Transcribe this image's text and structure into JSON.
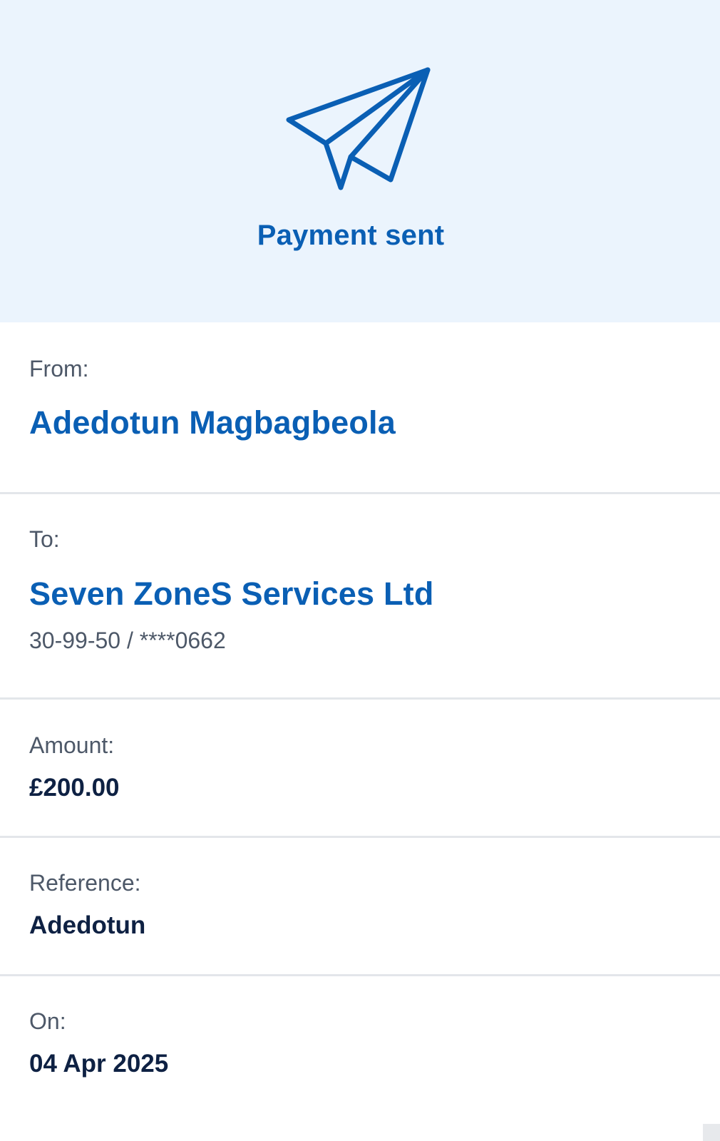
{
  "header": {
    "icon": "paper-plane-icon",
    "title": "Payment sent",
    "accent_color": "#0a5fb4",
    "background_color": "#ebf4fd"
  },
  "details": {
    "from": {
      "label": "From:",
      "name": "Adedotun Magbagbeola"
    },
    "to": {
      "label": "To:",
      "name": "Seven ZoneS Services Ltd",
      "account": "30-99-50 / ****0662"
    },
    "amount": {
      "label": "Amount:",
      "value": "£200.00"
    },
    "reference": {
      "label": "Reference:",
      "value": "Adedotun"
    },
    "date": {
      "label": "On:",
      "value": "04 Apr 2025"
    }
  }
}
